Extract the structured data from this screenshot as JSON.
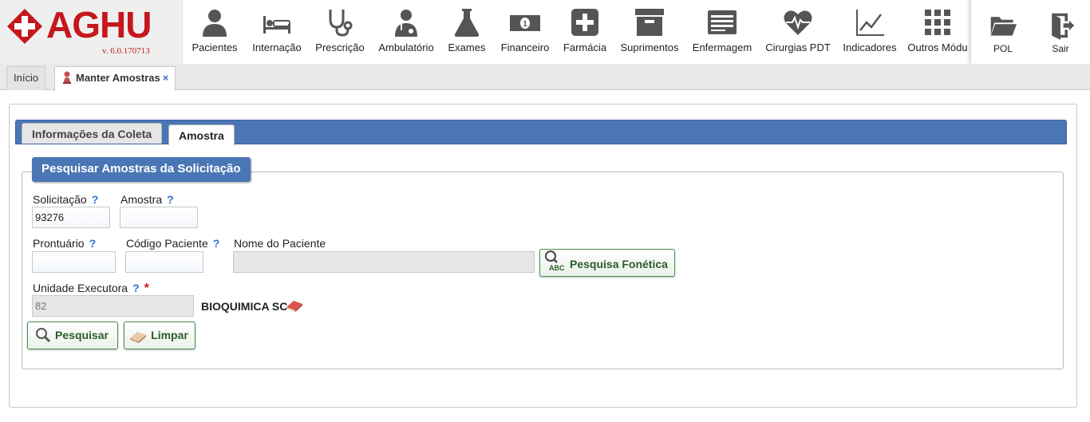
{
  "app": {
    "brand": "AGHU",
    "version": "v. 6.0.170713"
  },
  "modules": [
    {
      "label": "Pacientes",
      "icon": "user-icon"
    },
    {
      "label": "Internação",
      "icon": "bed-icon"
    },
    {
      "label": "Prescrição",
      "icon": "stethoscope-icon"
    },
    {
      "label": "Ambulatório",
      "icon": "doctor-icon"
    },
    {
      "label": "Exames",
      "icon": "flask-icon"
    },
    {
      "label": "Financeiro",
      "icon": "money-icon"
    },
    {
      "label": "Farmácia",
      "icon": "medical-cross-icon"
    },
    {
      "label": "Suprimentos",
      "icon": "archive-box-icon"
    },
    {
      "label": "Enfermagem",
      "icon": "list-icon"
    },
    {
      "label": "Cirurgias PDT",
      "icon": "heartbeat-icon"
    },
    {
      "label": "Indicadores",
      "icon": "line-chart-icon"
    },
    {
      "label": "Outros Módu",
      "icon": "grid-icon"
    }
  ],
  "right_nav": [
    {
      "label": "POL",
      "icon": "folder-icon"
    },
    {
      "label": "Sair",
      "icon": "exit-icon"
    }
  ],
  "page_tabs": [
    {
      "label": "Início"
    },
    {
      "label": "Manter Amostras",
      "close": "×"
    }
  ],
  "inner_tabs": [
    {
      "label": "Informações da Coleta"
    },
    {
      "label": "Amostra"
    }
  ],
  "form": {
    "legend": "Pesquisar Amostras da Solicitação",
    "help_mark": "?",
    "required_mark": "*",
    "solicitacao": {
      "label": "Solicitação",
      "value": "93276"
    },
    "amostra": {
      "label": "Amostra",
      "value": ""
    },
    "prontuario": {
      "label": "Prontuário",
      "value": ""
    },
    "codigo_paciente": {
      "label": "Código Paciente",
      "value": ""
    },
    "nome_paciente": {
      "label": "Nome do Paciente",
      "value": ""
    },
    "pesquisa_fonetica": {
      "label": "Pesquisa Fonética",
      "icon_text": "ABC"
    },
    "unidade_executora": {
      "label": "Unidade Executora",
      "value": "82",
      "name": "BIOQUIMICA SC"
    },
    "pesquisar_label": "Pesquisar",
    "limpar_label": "Limpar"
  },
  "colors": {
    "brand_red": "#c4181c",
    "tab_blue": "#4a76b5",
    "button_green": "#2a5d2a",
    "help_blue": "#2f6fd0"
  }
}
